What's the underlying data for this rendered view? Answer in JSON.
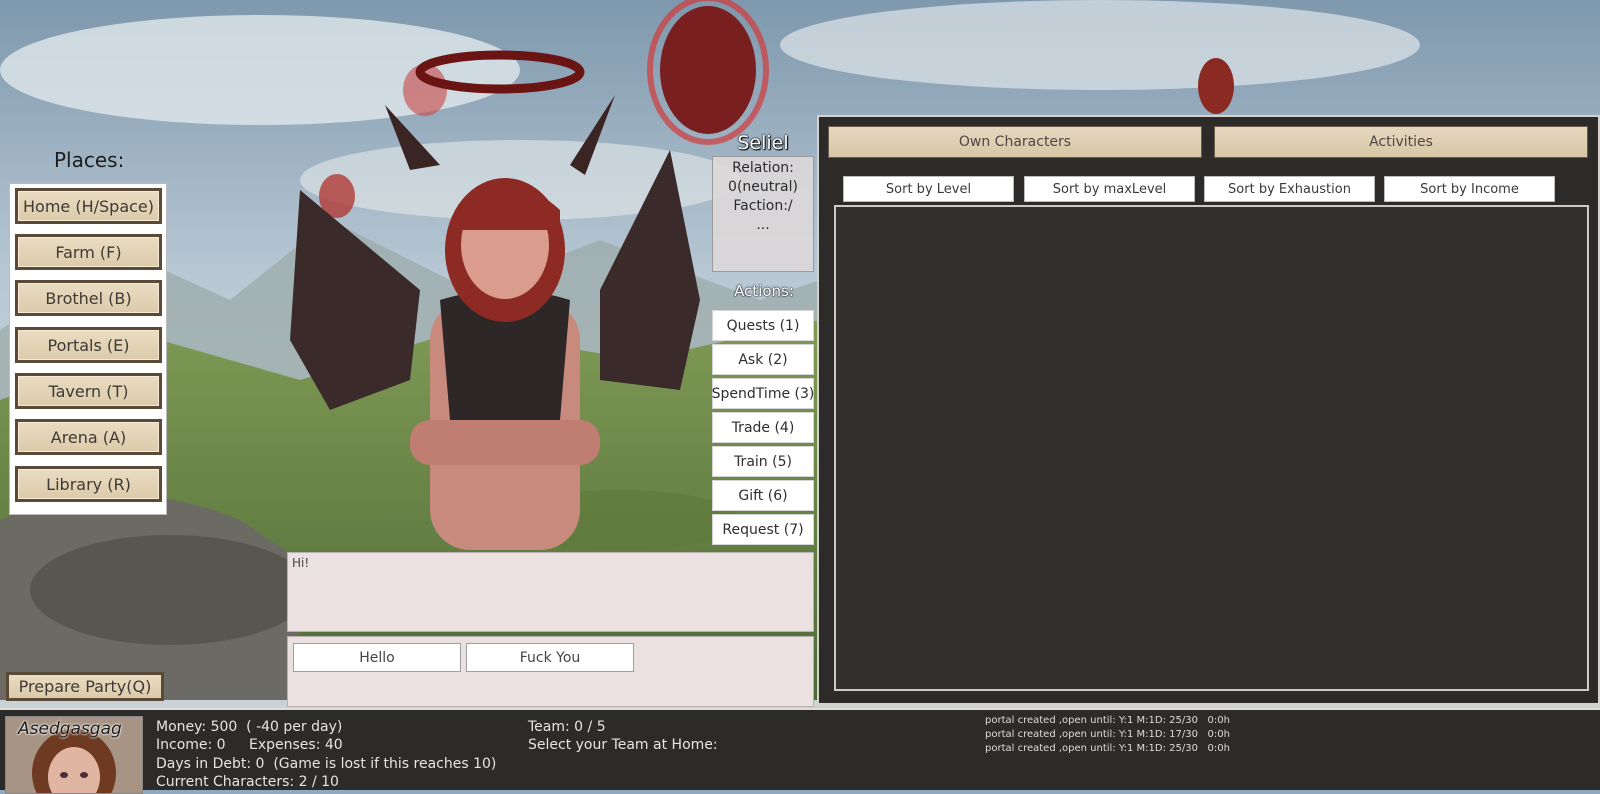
{
  "places": {
    "title": "Places:",
    "items": [
      {
        "label": "Home (H/Space)"
      },
      {
        "label": "Farm (F)"
      },
      {
        "label": "Brothel (B)"
      },
      {
        "label": "Portals (E)"
      },
      {
        "label": "Tavern (T)"
      },
      {
        "label": "Arena (A)"
      },
      {
        "label": "Library (R)"
      }
    ]
  },
  "prepare_party": "Prepare Party(Q)",
  "character": {
    "name": "Seliel",
    "relation_label": "Relation:",
    "relation_value": "0(neutral)",
    "faction": "Faction:/",
    "more": "..."
  },
  "actions": {
    "title": "Actions:",
    "items": [
      {
        "label": "Quests (1)"
      },
      {
        "label": "Ask (2)"
      },
      {
        "label": "SpendTime (3)"
      },
      {
        "label": "Trade (4)"
      },
      {
        "label": "Train (5)"
      },
      {
        "label": "Gift (6)"
      },
      {
        "label": "Request (7)"
      }
    ]
  },
  "dialog": {
    "text": "Hi!",
    "replies": [
      {
        "label": "Hello"
      },
      {
        "label": "Fuck You"
      }
    ]
  },
  "panel": {
    "tabs": [
      {
        "label": "Own Characters"
      },
      {
        "label": "Activities"
      }
    ],
    "sort_buttons": [
      {
        "label": "Sort by Level"
      },
      {
        "label": "Sort by maxLevel"
      },
      {
        "label": "Sort by Exhaustion"
      },
      {
        "label": "Sort by Income"
      }
    ]
  },
  "status": {
    "player_name": "Asedgasgag",
    "money": "Money: 500  ( -40 per day)",
    "income": "Income: 0",
    "expenses": "Expenses: 40",
    "debt": "Days in Debt: 0  (Game is lost if this reaches 10)",
    "characters": "Current Characters: 2 / 10",
    "team": "Team: 0 / 5",
    "team_select": "Select your Team at Home:",
    "log": [
      "portal created ,open until: Y:1 M:1D: 25/30   0:0h",
      "portal created ,open until: Y:1 M:1D: 17/30   0:0h",
      "portal created ,open until: Y:1 M:1D: 25/30   0:0h"
    ]
  }
}
